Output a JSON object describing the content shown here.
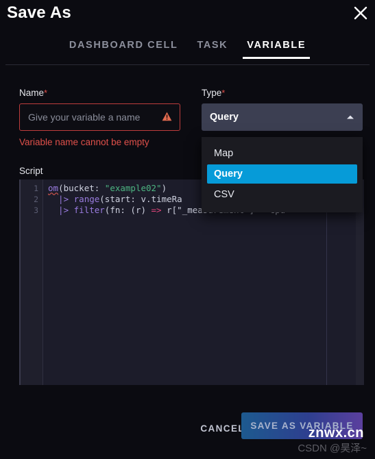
{
  "window": {
    "title": "Save As",
    "close_icon": "close-icon"
  },
  "tabs": [
    {
      "label": "DASHBOARD CELL",
      "active": false
    },
    {
      "label": "TASK",
      "active": false
    },
    {
      "label": "VARIABLE",
      "active": true
    }
  ],
  "form": {
    "name": {
      "label": "Name",
      "required_marker": "*",
      "value": "",
      "placeholder": "Give your variable a name",
      "warning_icon": "warning-triangle-icon",
      "error": "Variable name cannot be empty",
      "border_color": "#bf3d3d",
      "error_color": "#e0504a"
    },
    "type": {
      "label": "Type",
      "required_marker": "*",
      "selected": "Query",
      "expanded": true,
      "caret_icon": "caret-up-icon",
      "options": [
        "Map",
        "Query",
        "CSV"
      ],
      "highlight_color": "#069bd8"
    },
    "script": {
      "label": "Script",
      "line_numbers": [
        "1",
        "2",
        "3"
      ],
      "lines": [
        {
          "n": "1",
          "tokens": [
            {
              "t": "om",
              "c": "t-fn",
              "squiggle": true
            },
            {
              "t": "(bucket: ",
              "c": "t-pl"
            },
            {
              "t": "\"example02\"",
              "c": "t-str"
            },
            {
              "t": ")",
              "c": "t-pl"
            }
          ]
        },
        {
          "n": "2",
          "tokens": [
            {
              "t": "  |> ",
              "c": "t-key"
            },
            {
              "t": "range",
              "c": "t-key"
            },
            {
              "t": "(start: v.timeRa",
              "c": "t-pl"
            }
          ]
        },
        {
          "n": "3",
          "tokens": [
            {
              "t": "  |> ",
              "c": "t-key"
            },
            {
              "t": "filter",
              "c": "t-key"
            },
            {
              "t": "(fn: (r) ",
              "c": "t-pl"
            },
            {
              "t": "=>",
              "c": "t-arrow"
            },
            {
              "t": " r[\"_measurement\"]   cpu",
              "c": "t-pl"
            }
          ]
        }
      ]
    }
  },
  "footer": {
    "cancel_label": "CANCEL",
    "save_label": "SAVE AS VARIABLE"
  },
  "watermarks": {
    "primary": "znwx.cn",
    "secondary": "CSDN @昊泽~"
  }
}
